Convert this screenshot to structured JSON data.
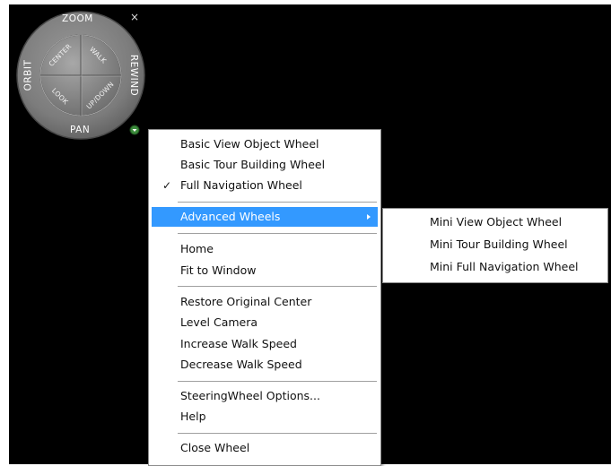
{
  "wheel": {
    "labels": {
      "zoom": "ZOOM",
      "orbit": "ORBIT",
      "rewind": "REWIND",
      "pan": "PAN",
      "center": "CENTER",
      "walk": "WALK",
      "look": "LOOK",
      "updown": "UP/DOWN"
    },
    "close_glyph": "×",
    "menu_glyph": "▾"
  },
  "context_menu": {
    "items": [
      {
        "label": "Basic View Object Wheel"
      },
      {
        "label": "Basic Tour Building Wheel"
      },
      {
        "label": "Full Navigation Wheel",
        "check": "✓"
      },
      {
        "label": "Advanced Wheels"
      },
      {
        "label": "Home"
      },
      {
        "label": "Fit to Window"
      },
      {
        "label": "Restore Original Center"
      },
      {
        "label": "Level Camera"
      },
      {
        "label": "Increase Walk Speed"
      },
      {
        "label": "Decrease Walk Speed"
      },
      {
        "label": "SteeringWheel Options..."
      },
      {
        "label": "Help"
      },
      {
        "label": "Close Wheel"
      }
    ]
  },
  "submenu": {
    "items": [
      {
        "label": "Mini View Object Wheel"
      },
      {
        "label": "Mini Tour Building Wheel"
      },
      {
        "label": "Mini Full Navigation Wheel"
      }
    ]
  },
  "colors": {
    "viewport_bg": "#000000",
    "menu_bg": "#ffffff",
    "highlight": "#3399ff",
    "wheel_gray": "#7a7a7a"
  }
}
